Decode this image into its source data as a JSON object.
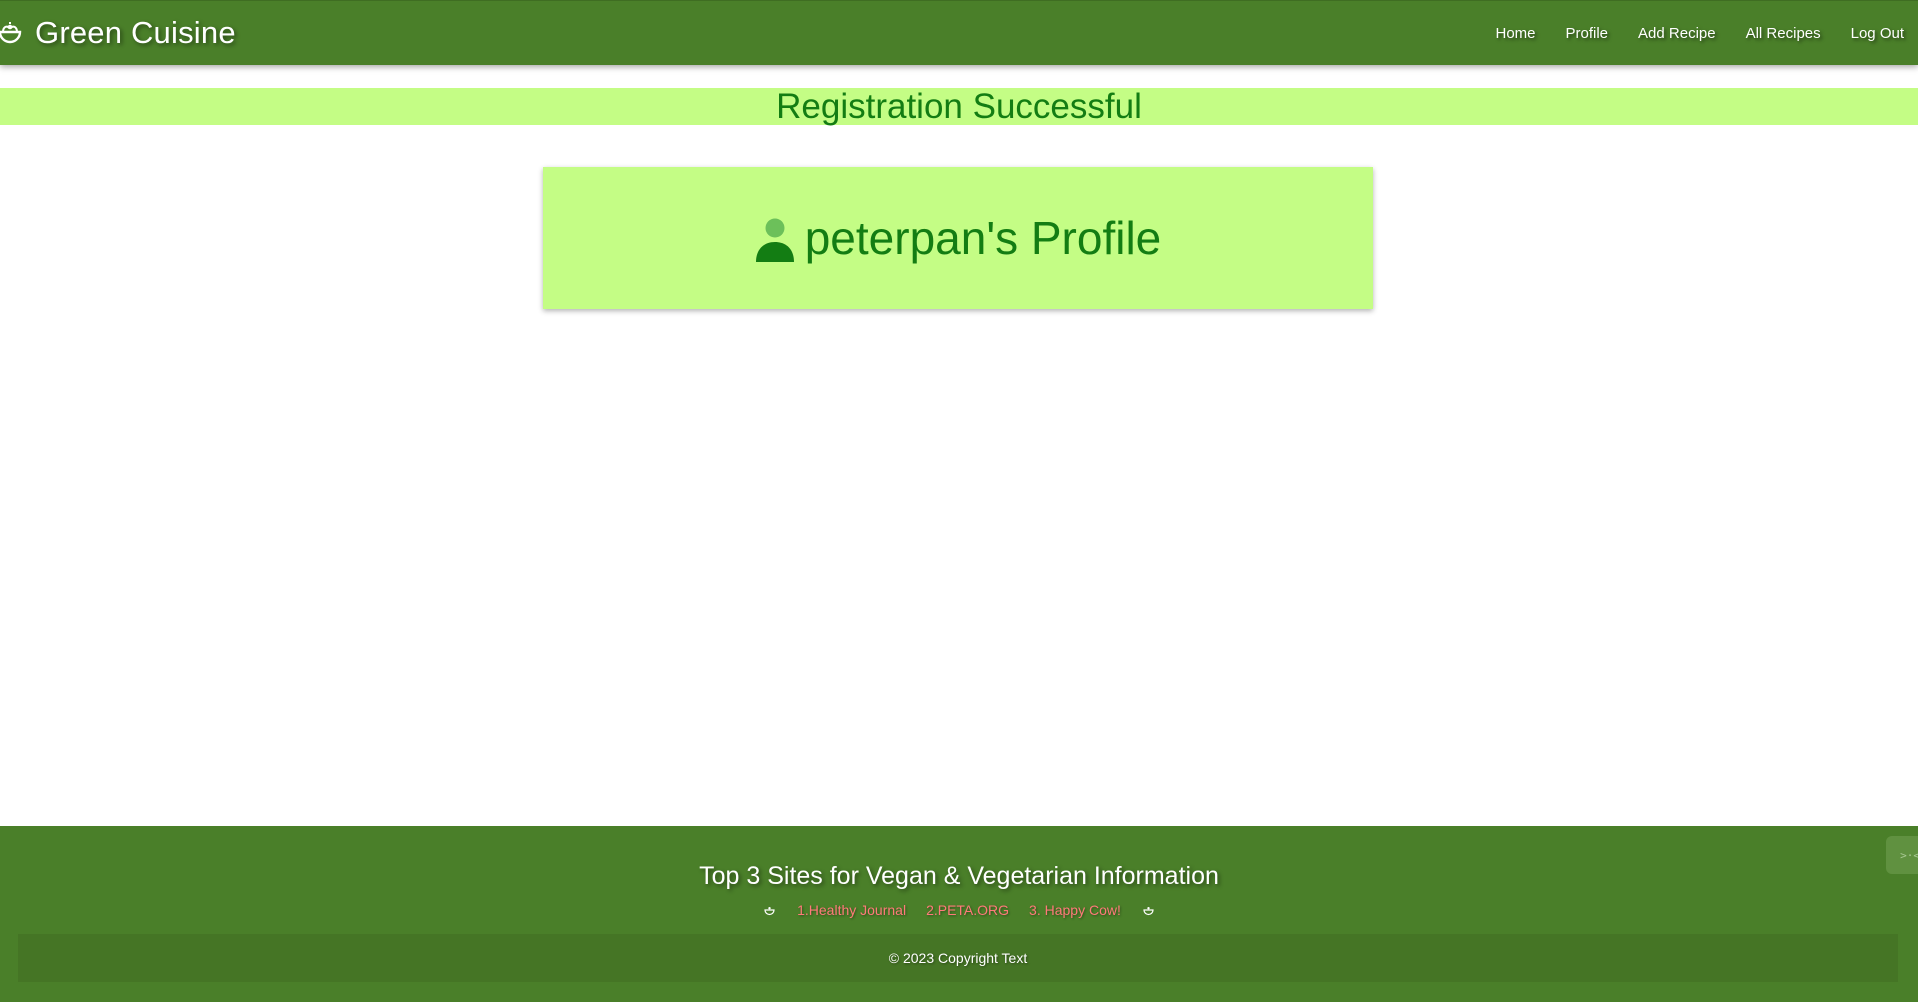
{
  "navbar": {
    "brand": {
      "icon": "salad-bowl-icon",
      "name": "Green Cuisine"
    },
    "links": [
      "Home",
      "Profile",
      "Add Recipe",
      "All Recipes",
      "Log Out"
    ]
  },
  "banner": {
    "message": "Registration Successful"
  },
  "profile": {
    "icon": "user-icon",
    "heading": "peterpan's Profile"
  },
  "footer": {
    "title": "Top 3 Sites for Vegan & Vegetarian Information",
    "links": [
      "1.Healthy Journal",
      "2.PETA.ORG",
      "3. Happy Cow!"
    ],
    "copyright": "© 2023 Copyright Text",
    "widget_glyph": ">·<"
  },
  "colors": {
    "nav_green": "#4a7f29",
    "light_green": "#c4fd85",
    "text_green": "#137d13",
    "link_red": "#ff7a7a"
  }
}
